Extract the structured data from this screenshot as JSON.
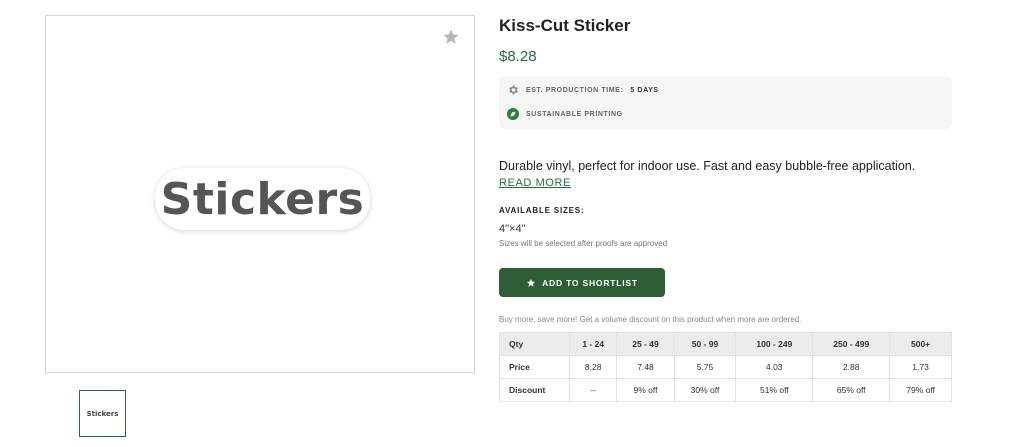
{
  "product": {
    "title": "Kiss-Cut Sticker",
    "price": "$8.28",
    "image_text": "Stickers",
    "thumbnail_text": "Stickers"
  },
  "info": {
    "production_label": "EST. PRODUCTION TIME:",
    "production_value": "5 DAYS",
    "sustainable_label": "SUSTAINABLE PRINTING"
  },
  "description": {
    "text": "Durable vinyl, perfect for indoor use. Fast and easy bubble-free application.",
    "read_more": "READ MORE"
  },
  "sizes": {
    "label": "AVAILABLE SIZES:",
    "value": "4\"×4\"",
    "note": "Sizes will be selected after proofs are approved"
  },
  "actions": {
    "shortlist_label": "ADD TO SHORTLIST"
  },
  "volume": {
    "note": "Buy more, save more! Get a volume discount on this product when more are ordered.",
    "headers": [
      "Qty",
      "1 - 24",
      "25 - 49",
      "50 - 99",
      "100 - 249",
      "250 - 499",
      "500+"
    ],
    "price_row": [
      "Price",
      "8.28",
      "7.48",
      "5.75",
      "4.03",
      "2.88",
      "1.73"
    ],
    "discount_row": [
      "Discount",
      "--",
      "9% off",
      "30% off",
      "51% off",
      "65% off",
      "79% off"
    ]
  },
  "colors": {
    "brand_green": "#2d5e36",
    "price_green": "#2d6a3a"
  },
  "icons": {
    "favorite": "star-icon",
    "production": "gear-icon",
    "sustainable": "leaf-icon",
    "shortlist": "star-icon"
  }
}
